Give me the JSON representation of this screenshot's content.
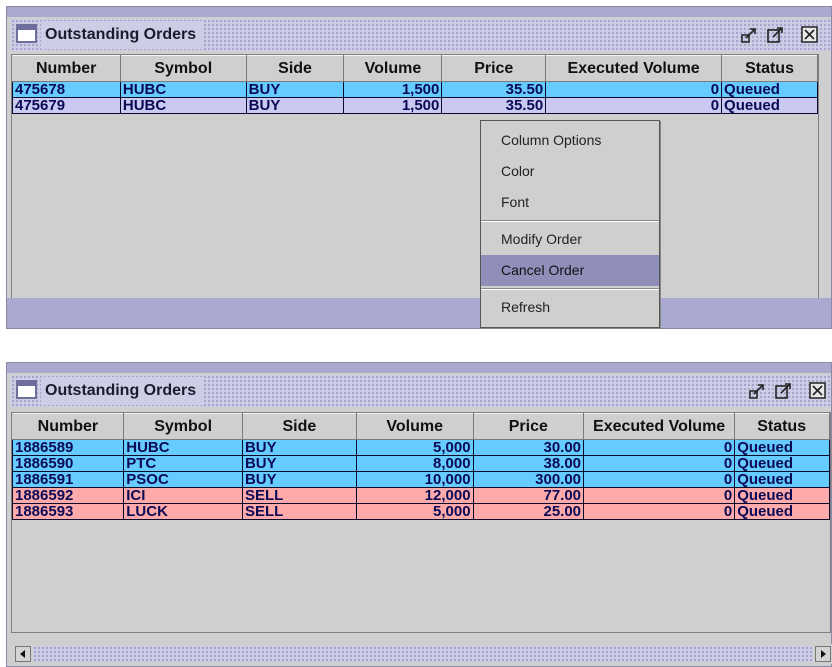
{
  "window1": {
    "title": "Outstanding Orders",
    "columns": [
      "Number",
      "Symbol",
      "Side",
      "Volume",
      "Price",
      "Executed Volume",
      "Status"
    ],
    "rows": [
      {
        "number": "475678",
        "symbol": "HUBC",
        "side": "BUY",
        "volume": "1,500",
        "price": "35.50",
        "executed": "0",
        "status": "Queued"
      },
      {
        "number": "475679",
        "symbol": "HUBC",
        "side": "BUY",
        "volume": "1,500",
        "price": "35.50",
        "executed": "0",
        "status": "Queued"
      }
    ],
    "context_menu": [
      {
        "label": "Column Options"
      },
      {
        "label": "Color"
      },
      {
        "label": "Font"
      },
      {
        "label": "Modify Order"
      },
      {
        "label": "Cancel Order"
      },
      {
        "label": "Refresh"
      }
    ]
  },
  "window2": {
    "title": "Outstanding Orders",
    "columns": [
      "Number",
      "Symbol",
      "Side",
      "Volume",
      "Price",
      "Executed Volume",
      "Status"
    ],
    "rows": [
      {
        "number": "1886589",
        "symbol": "HUBC",
        "side": "BUY",
        "volume": "5,000",
        "price": "30.00",
        "executed": "0",
        "status": "Queued"
      },
      {
        "number": "1886590",
        "symbol": "PTC",
        "side": "BUY",
        "volume": "8,000",
        "price": "38.00",
        "executed": "0",
        "status": "Queued"
      },
      {
        "number": "1886591",
        "symbol": "PSOC",
        "side": "BUY",
        "volume": "10,000",
        "price": "300.00",
        "executed": "0",
        "status": "Queued"
      },
      {
        "number": "1886592",
        "symbol": "ICI",
        "side": "SELL",
        "volume": "12,000",
        "price": "77.00",
        "executed": "0",
        "status": "Queued"
      },
      {
        "number": "1886593",
        "symbol": "LUCK",
        "side": "SELL",
        "volume": "5,000",
        "price": "25.00",
        "executed": "0",
        "status": "Queued"
      }
    ]
  },
  "colors": {
    "buy_row": "#66ccff",
    "sell_row": "#ffaaaa",
    "unselected_row": "#c9c9f1",
    "menu_highlight": "#8f8fba",
    "title_bar": "#cdcde6"
  },
  "icons": [
    "window-icon",
    "undock-icon",
    "maximize-icon",
    "close-icon",
    "scroll-left-icon",
    "scroll-right-icon"
  ]
}
